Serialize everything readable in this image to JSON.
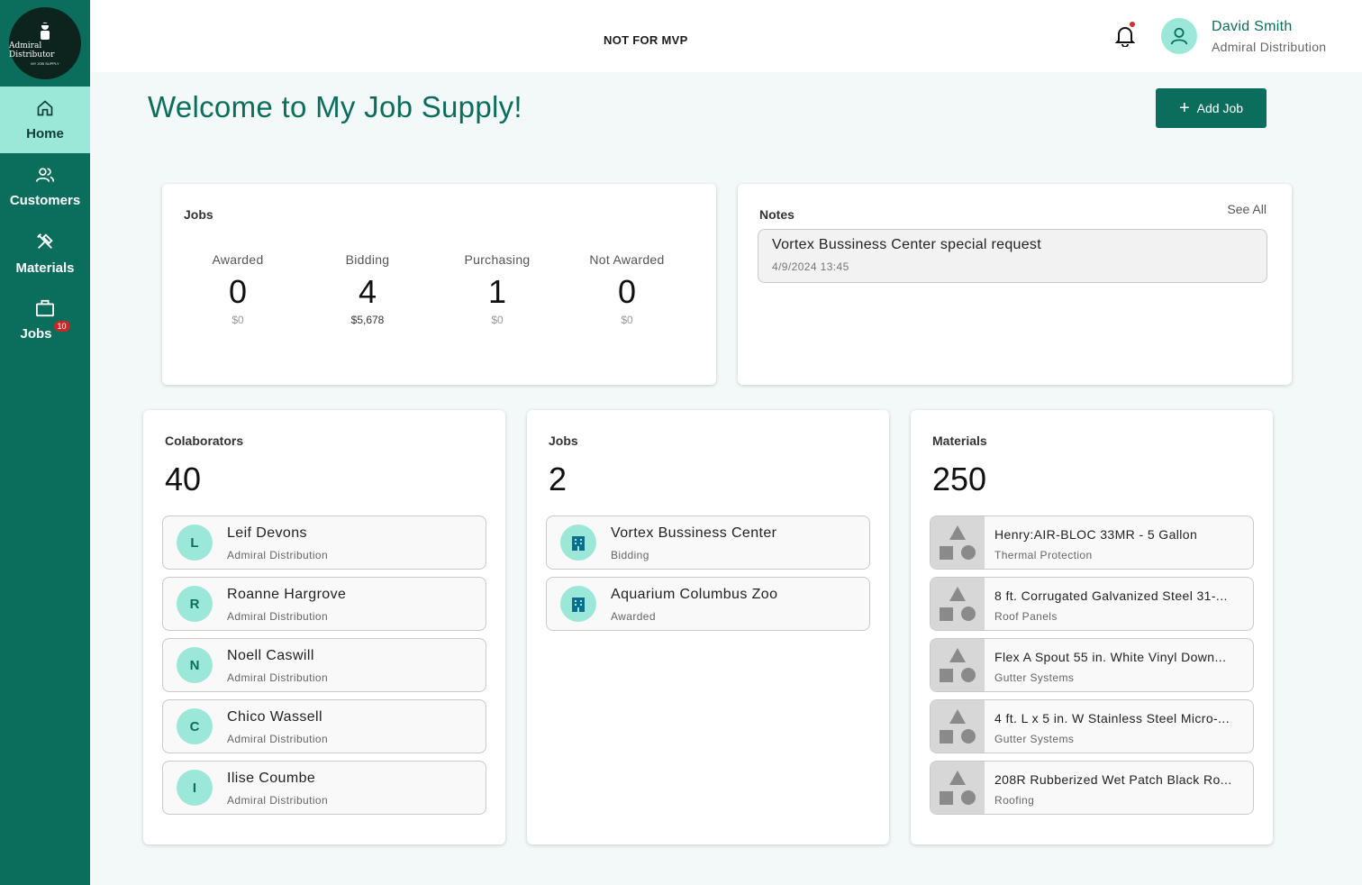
{
  "sidebar": {
    "logo": {
      "line1": "Admiral Distributor",
      "line2": "MY JOB SUPPLY"
    },
    "items": [
      {
        "label": "Home",
        "icon": "home-icon",
        "active": true
      },
      {
        "label": "Customers",
        "icon": "users-icon"
      },
      {
        "label": "Materials",
        "icon": "tools-icon"
      },
      {
        "label": "Jobs",
        "icon": "briefcase-icon",
        "badge": "10"
      }
    ]
  },
  "header": {
    "banner": "NOT FOR MVP",
    "user": {
      "name": "David Smith",
      "org": "Admiral Distribution"
    }
  },
  "main": {
    "title": "Welcome to My Job Supply!",
    "add_job_label": "Add Job",
    "jobs_summary": {
      "title": "Jobs",
      "stats": [
        {
          "label": "Awarded",
          "count": "0",
          "amount": "$0"
        },
        {
          "label": "Bidding",
          "count": "4",
          "amount": "$5,678"
        },
        {
          "label": "Purchasing",
          "count": "1",
          "amount": "$0"
        },
        {
          "label": "Not Awarded",
          "count": "0",
          "amount": "$0"
        }
      ]
    },
    "notes": {
      "title": "Notes",
      "see_all": "See All",
      "items": [
        {
          "title": "Vortex Bussiness Center special request",
          "date": "4/9/2024 13:45"
        }
      ]
    },
    "collaborators": {
      "title": "Colaborators",
      "count": "40",
      "items": [
        {
          "initial": "L",
          "name": "Leif Devons",
          "org": "Admiral Distribution"
        },
        {
          "initial": "R",
          "name": "Roanne Hargrove",
          "org": "Admiral Distribution"
        },
        {
          "initial": "N",
          "name": "Noell Caswill",
          "org": "Admiral Distribution"
        },
        {
          "initial": "C",
          "name": "Chico Wassell",
          "org": "Admiral Distribution"
        },
        {
          "initial": "I",
          "name": "Ilise Coumbe",
          "org": "Admiral Distribution"
        }
      ]
    },
    "jobs": {
      "title": "Jobs",
      "count": "2",
      "items": [
        {
          "name": "Vortex Bussiness Center",
          "status": "Bidding"
        },
        {
          "name": "Aquarium Columbus Zoo",
          "status": "Awarded"
        }
      ]
    },
    "materials": {
      "title": "Materials",
      "count": "250",
      "items": [
        {
          "name": "Henry:AIR-BLOC 33MR - 5 Gallon",
          "category": "Thermal Protection"
        },
        {
          "name": "8 ft. Corrugated Galvanized Steel 31-...",
          "category": "Roof Panels"
        },
        {
          "name": "Flex A Spout 55 in. White Vinyl Down...",
          "category": "Gutter Systems"
        },
        {
          "name": "4 ft. L x 5 in. W Stainless Steel Micro-...",
          "category": "Gutter Systems"
        },
        {
          "name": "208R Rubberized Wet Patch Black Ro...",
          "category": "Roofing"
        }
      ]
    }
  },
  "colors": {
    "primary": "#0b6e5c",
    "accent": "#9ce8d8",
    "badge": "#c62828",
    "background": "#f3f9f8"
  }
}
